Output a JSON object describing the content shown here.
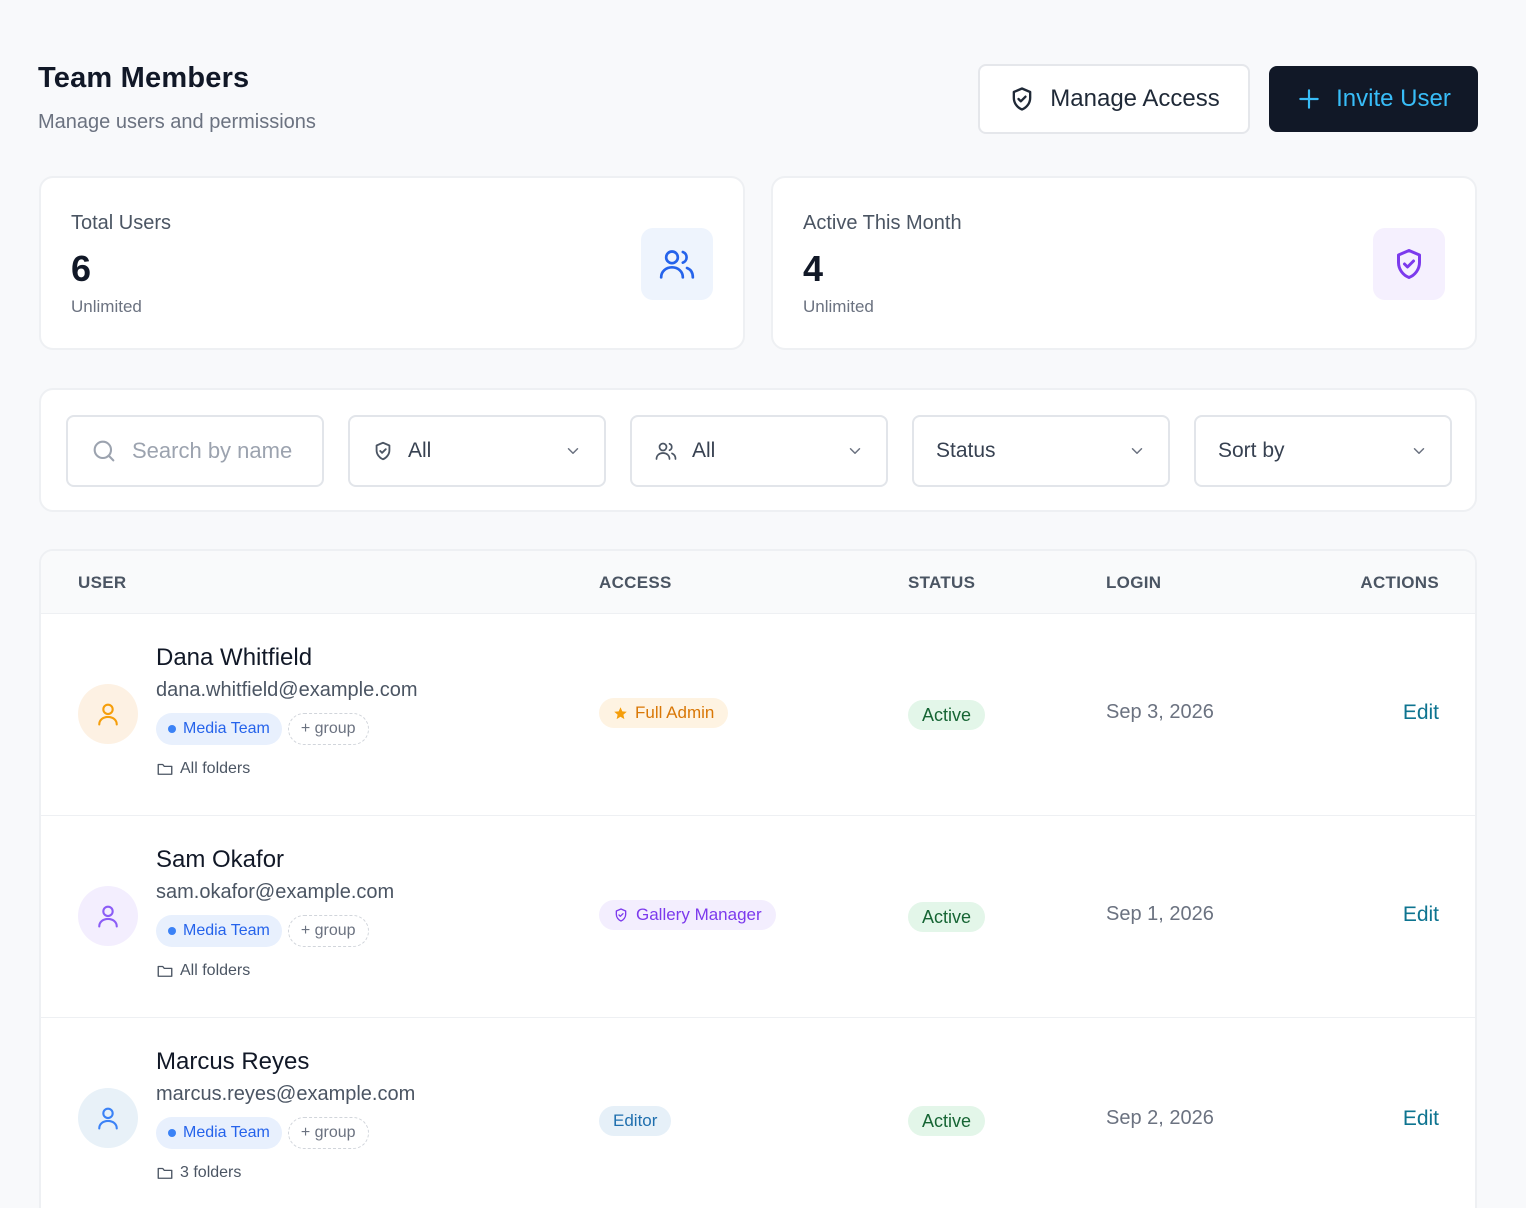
{
  "header": {
    "title": "Team Members",
    "subtitle": "Manage users and permissions",
    "manage_access_label": "Manage Access",
    "invite_user_label": "Invite User"
  },
  "stats": [
    {
      "label": "Total Users",
      "value": "6",
      "note": "Unlimited",
      "icon": "users-icon",
      "color": "#2563eb"
    },
    {
      "label": "Active This Month",
      "value": "4",
      "note": "Unlimited",
      "icon": "shield-check-icon",
      "color": "#7c3aed"
    }
  ],
  "filters": {
    "search_placeholder": "Search by name",
    "access_value": "All",
    "group_value": "All",
    "status_value": "Status",
    "sort_value": "Sort by"
  },
  "table": {
    "columns": {
      "user": "USER",
      "access": "ACCESS",
      "status": "STATUS",
      "login": "LOGIN",
      "actions": "ACTIONS"
    },
    "rows": [
      {
        "name": "Dana Whitfield",
        "email": "dana.whitfield@example.com",
        "group": "Media Team",
        "add_group": "+ group",
        "folders": "All folders",
        "access": "Full Admin",
        "access_icon": "star-icon",
        "status": "Active",
        "login": "Sep 3, 2026",
        "action": "Edit",
        "avatar_color": "#f59e0b"
      },
      {
        "name": "Sam Okafor",
        "email": "sam.okafor@example.com",
        "group": "Media Team",
        "add_group": "+ group",
        "folders": "All folders",
        "access": "Gallery Manager",
        "access_icon": "shield-icon",
        "status": "Active",
        "login": "Sep 1, 2026",
        "action": "Edit",
        "avatar_color": "#8b5cf6"
      },
      {
        "name": "Marcus Reyes",
        "email": "marcus.reyes@example.com",
        "group": "Media Team",
        "add_group": "+ group",
        "folders": "3 folders",
        "access": "Editor",
        "access_icon": "",
        "status": "Active",
        "login": "Sep 2, 2026",
        "action": "Edit",
        "avatar_color": "#3b82f6"
      }
    ]
  }
}
